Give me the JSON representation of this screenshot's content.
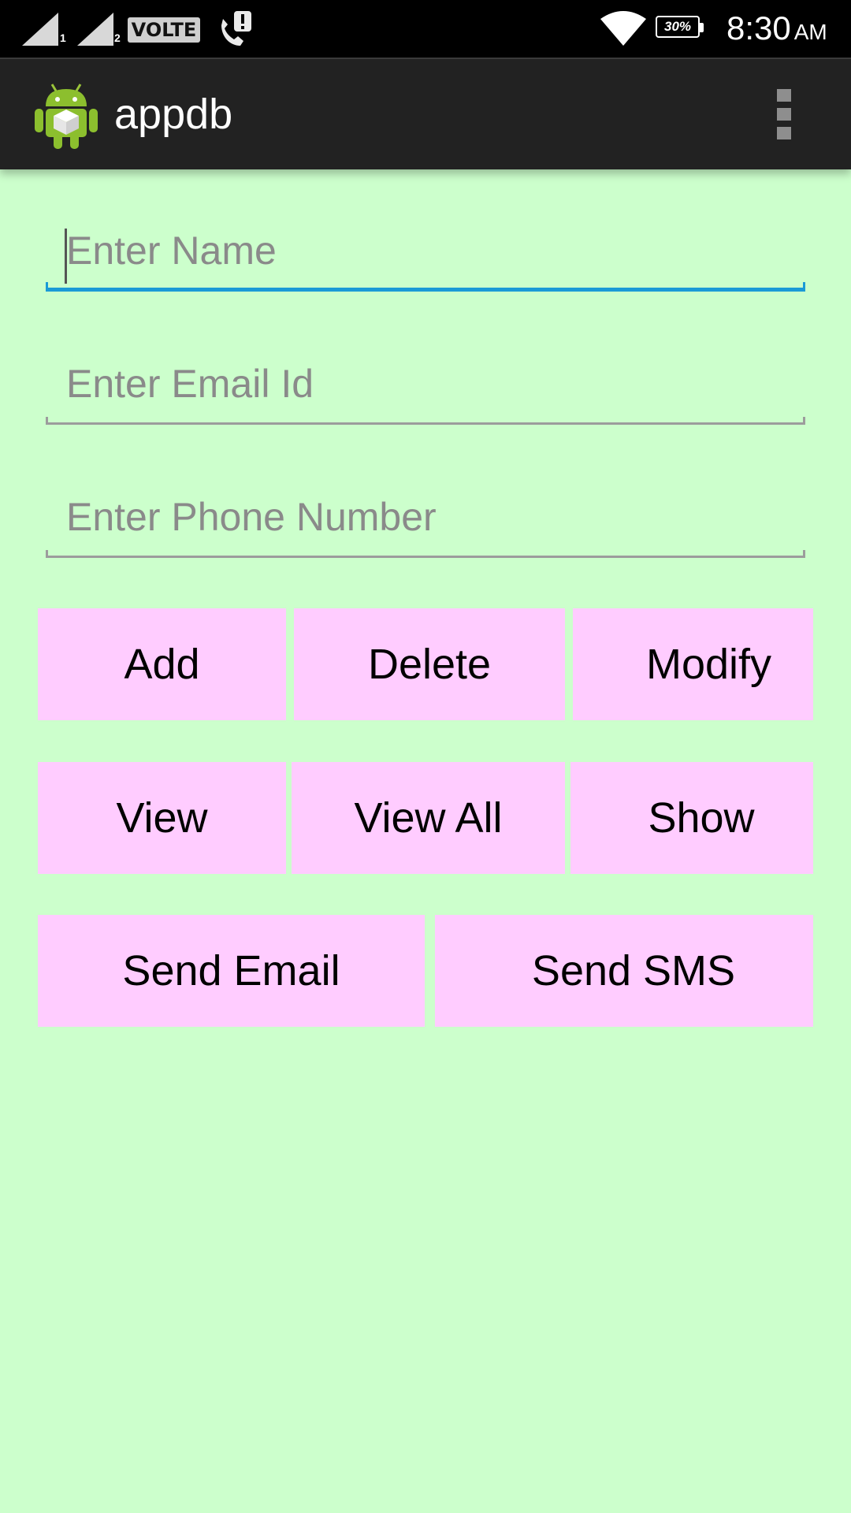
{
  "status_bar": {
    "sim1_label": "1",
    "sim2_label": "2",
    "volte_label": "VOLTE",
    "battery_percent": "30%",
    "battery_level": 0.3,
    "time": "8:30",
    "ampm": "AM"
  },
  "action_bar": {
    "title": "appdb",
    "icon": "android-robot-icon",
    "overflow_icon": "overflow-menu-icon",
    "color": "#222222"
  },
  "form": {
    "name_placeholder": "Enter Name",
    "name_value": "",
    "email_placeholder": "Enter Email Id",
    "email_value": "",
    "phone_placeholder": "Enter Phone Number",
    "phone_value": ""
  },
  "buttons": {
    "add": "Add",
    "delete": "Delete",
    "modify": "Modify",
    "view": "View",
    "view_all": "View All",
    "show": "Show",
    "send_email": "Send Email",
    "send_sms": "Send SMS"
  },
  "colors": {
    "background": "#ccffcc",
    "button": "#ffccff",
    "focus_accent": "#1a9ad6"
  }
}
